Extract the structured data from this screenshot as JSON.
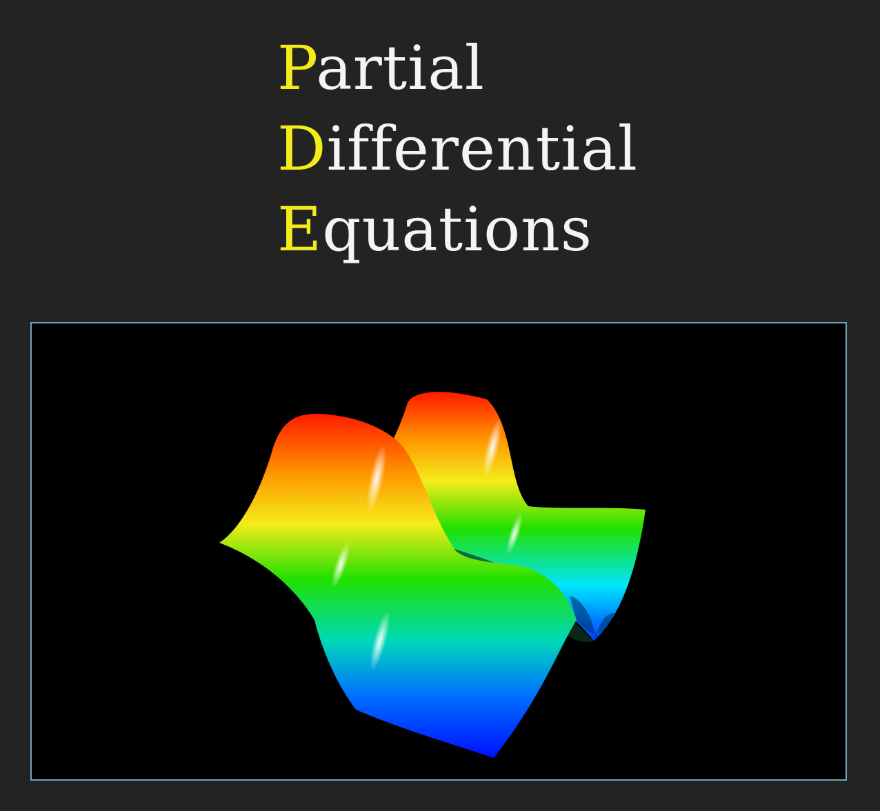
{
  "title": {
    "lines": [
      {
        "initial": "P",
        "rest": "artial"
      },
      {
        "initial": "D",
        "rest": "ifferential"
      },
      {
        "initial": "E",
        "rest": "quations"
      }
    ]
  },
  "colors": {
    "background": "#232323",
    "initial": "#f4ec1a",
    "text": "#f4f4f4",
    "viewer_border": "#6fa6b8",
    "viewer_background": "#000000"
  },
  "visualization": {
    "subject": "surface-wave-plot",
    "colormap": [
      "#0000ff",
      "#00e5ff",
      "#00e000",
      "#f4ec1a",
      "#ff0000"
    ]
  }
}
